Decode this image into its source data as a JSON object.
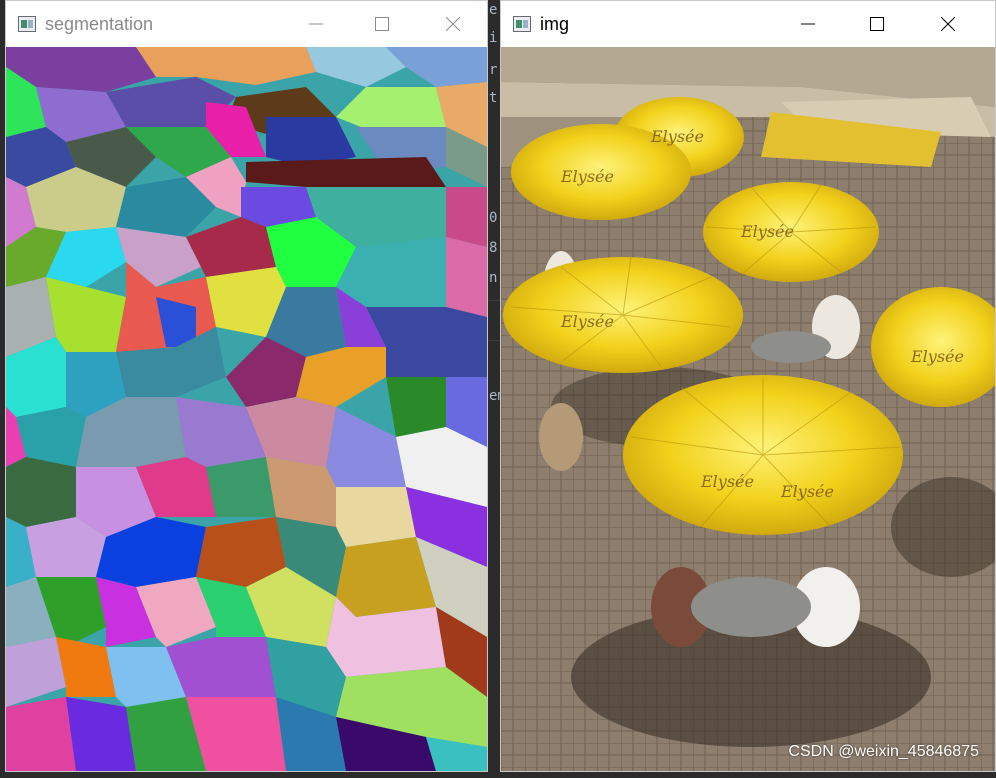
{
  "segmentation_window": {
    "title": "segmentation",
    "icon": "opencv-window-icon"
  },
  "img_window": {
    "title": "img",
    "icon": "opencv-window-icon"
  },
  "window_controls": [
    "minimize-icon",
    "maximize-icon",
    "close-icon"
  ],
  "background_editor_chars": [
    "e",
    "i",
    "r",
    "t",
    "0",
    "8",
    "n",
    "em"
  ],
  "umbrella_brand": "Elysée",
  "watermark": "CSDN @weixin_45846875",
  "colors": {
    "umbrella": "#f2d21c",
    "pavement": "#8d7e6e",
    "titlebar": "#ffffff"
  }
}
